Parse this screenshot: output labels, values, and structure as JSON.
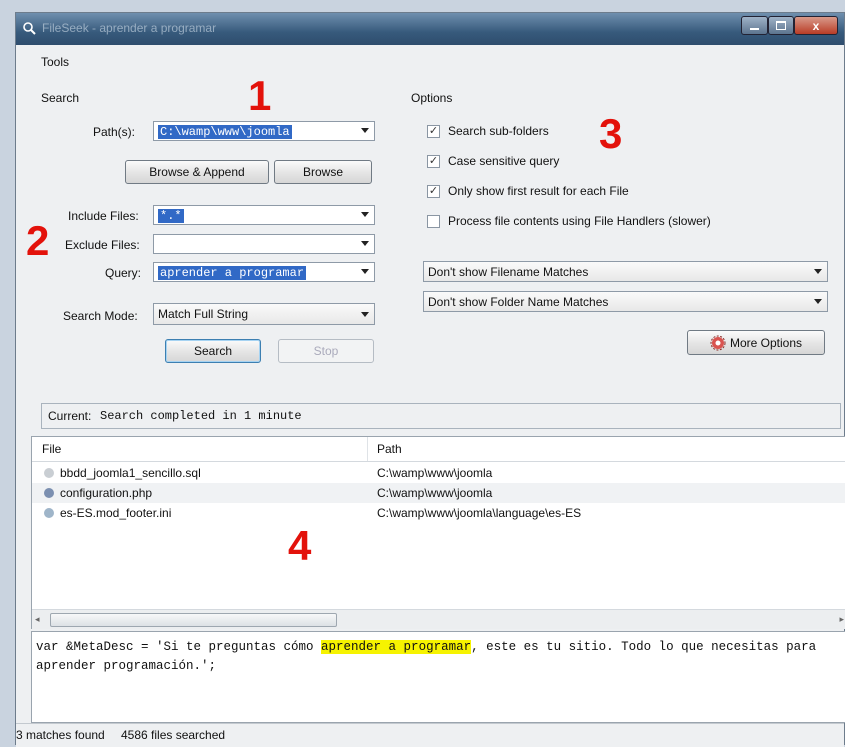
{
  "window": {
    "title": "FileSeek - aprender a programar"
  },
  "menu": {
    "tools": "Tools"
  },
  "search": {
    "heading": "Search",
    "path_label": "Path(s):",
    "path_value": "C:\\wamp\\www\\joomla",
    "browse_append": "Browse & Append",
    "browse": "Browse",
    "include_label": "Include Files:",
    "include_value": "*.*",
    "exclude_label": "Exclude Files:",
    "exclude_value": "",
    "query_label": "Query:",
    "query_value": "aprender a programar",
    "mode_label": "Search Mode:",
    "mode_value": "Match Full String",
    "search_btn": "Search",
    "stop_btn": "Stop"
  },
  "options": {
    "heading": "Options",
    "checks": [
      {
        "label": "Search sub-folders",
        "checked": true
      },
      {
        "label": "Case sensitive query",
        "checked": true
      },
      {
        "label": "Only show first result for each File",
        "checked": true
      },
      {
        "label": "Process file contents using File Handlers (slower)",
        "checked": false
      }
    ],
    "filename_matches": "Don't show Filename Matches",
    "folder_matches": "Don't show Folder Name Matches",
    "more_options": "More Options"
  },
  "annotations": {
    "n1": "1",
    "n2": "2",
    "n3": "3",
    "n4": "4"
  },
  "current": {
    "label": "Current:",
    "value": "Search completed in 1 minute"
  },
  "results": {
    "col_file": "File",
    "col_path": "Path",
    "rows": [
      {
        "file": "bbdd_joomla1_sencillo.sql",
        "path": "C:\\wamp\\www\\joomla",
        "icon": "sql-file-icon",
        "color": "#c9ced3"
      },
      {
        "file": "configuration.php",
        "path": "C:\\wamp\\www\\joomla",
        "icon": "php-file-icon",
        "color": "#7b8fb0"
      },
      {
        "file": "es-ES.mod_footer.ini",
        "path": "C:\\wamp\\www\\joomla\\language\\es-ES",
        "icon": "ini-file-icon",
        "color": "#9fb5c9"
      }
    ]
  },
  "preview": {
    "line_before": "var &MetaDesc = 'Si te preguntas cómo ",
    "highlight": "aprender a programar",
    "line_after": ", este es tu sitio. Todo lo que necesitas para aprender programación.';"
  },
  "status": {
    "matches": "3 matches found",
    "searched": "4586 files searched"
  }
}
